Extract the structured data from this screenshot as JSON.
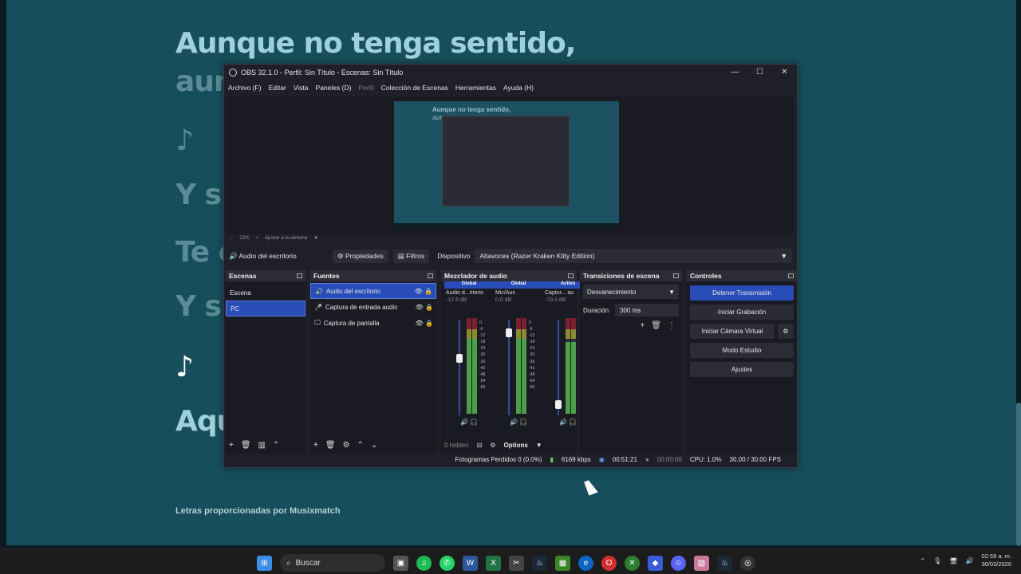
{
  "background": {
    "lyrics": [
      {
        "text": "Aunque no tenga sentido,",
        "style": "light"
      },
      {
        "text": "aun",
        "style": "dim"
      },
      {
        "text": "♪",
        "style": "dim"
      },
      {
        "text": "Y si",
        "style": "dim"
      },
      {
        "text": "Te c",
        "style": "dim"
      },
      {
        "text": "Y si",
        "style": "dim"
      },
      {
        "text": "♪",
        "style": "active"
      },
      {
        "text": "Aqu",
        "style": "light"
      }
    ],
    "credit": "Letras proporcionadas por Musixmatch"
  },
  "obs": {
    "title": "OBS 32.1.0 - Perfil: Sin Título - Escenas: Sin Título",
    "menu": [
      "Archivo (F)",
      "Editar",
      "Vista",
      "Paneles (D)",
      "Perfil",
      "Colección de Escenas",
      "Herramientas",
      "Ayuda (H)"
    ],
    "preview": {
      "lyric1": "Aunque no tenga sentido,",
      "lyric2": "aur"
    },
    "zoom": {
      "minus": "−",
      "value": "22%",
      "plus": "+",
      "fit": "Ajustar a la ventana"
    },
    "source_bar": {
      "selected_source": "Audio del escritorio",
      "properties": "Propiedades",
      "filters": "Filtros",
      "device_label": "Dispositivo",
      "device_value": "Altavoces (Razer Kraken Kitty Edition)"
    },
    "scenes": {
      "title": "Escenas",
      "items": [
        "Escena",
        "PC"
      ]
    },
    "sources": {
      "title": "Fuentes",
      "items": [
        "Audio del escritorio",
        "Captura de entrada audio",
        "Captura de pantalla"
      ]
    },
    "mixer": {
      "title": "Mezclador de audio",
      "channels": [
        {
          "tag": "Global",
          "name": "Audio d...ritorio",
          "db": "-12.6 dB",
          "level": 0.82,
          "fader": 0.62
        },
        {
          "tag": "Global",
          "name": "Mic/Aux",
          "db": "0.0 dB",
          "level": 0.78,
          "fader": 0.9
        },
        {
          "tag": "Activo",
          "name": "Captur... au",
          "db": "-79.3 dB",
          "level": 0.75,
          "fader": 0.1
        }
      ],
      "scale": [
        "0",
        "-6",
        "-12",
        "-18",
        "-24",
        "-30",
        "-36",
        "-42",
        "-48",
        "-54",
        "-60"
      ],
      "hidden": "0 hidden",
      "options": "Options"
    },
    "transitions": {
      "title": "Transiciones de escena",
      "type": "Desvanecimiento",
      "duration_label": "Duración",
      "duration_value": "300 ms"
    },
    "controls": {
      "title": "Controles",
      "buttons": [
        "Detener Transmisión",
        "Iniciar Grabación",
        "Iniciar Cámara Virtual",
        "Modo Estudio",
        "Ajustes"
      ]
    },
    "status": {
      "dropped": "Fotogramas Perdidos 0 (0.0%)",
      "bitrate": "6169 kbps",
      "stream_time": "00:51:21",
      "rec_time": "00:00:00",
      "cpu": "CPU: 1.0%",
      "fps": "30.00 / 30.00 FPS"
    }
  },
  "taskbar": {
    "search": "Buscar",
    "time": "02:59 a. m.",
    "date": "30/03/2026"
  },
  "colors": {
    "accent": "#284cb8",
    "panel": "#1e1f28",
    "lyrics_bg": "#174e5b"
  }
}
